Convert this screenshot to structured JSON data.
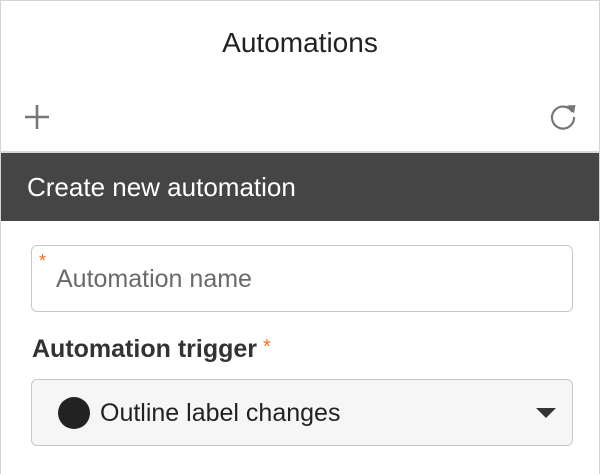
{
  "panel": {
    "title": "Automations"
  },
  "toolbar": {
    "add_icon": "plus-icon",
    "refresh_icon": "refresh-icon"
  },
  "section": {
    "header": "Create new automation"
  },
  "form": {
    "name_field": {
      "placeholder": "Automation name",
      "value": "",
      "required_marker": "*"
    },
    "trigger": {
      "label": "Automation trigger",
      "required_marker": "*",
      "selected_value": "Outline label changes",
      "selected_icon": "filled-circle-icon"
    }
  },
  "colors": {
    "header_bg": "#454545",
    "required": "#e8742c",
    "icon": "#777777"
  }
}
